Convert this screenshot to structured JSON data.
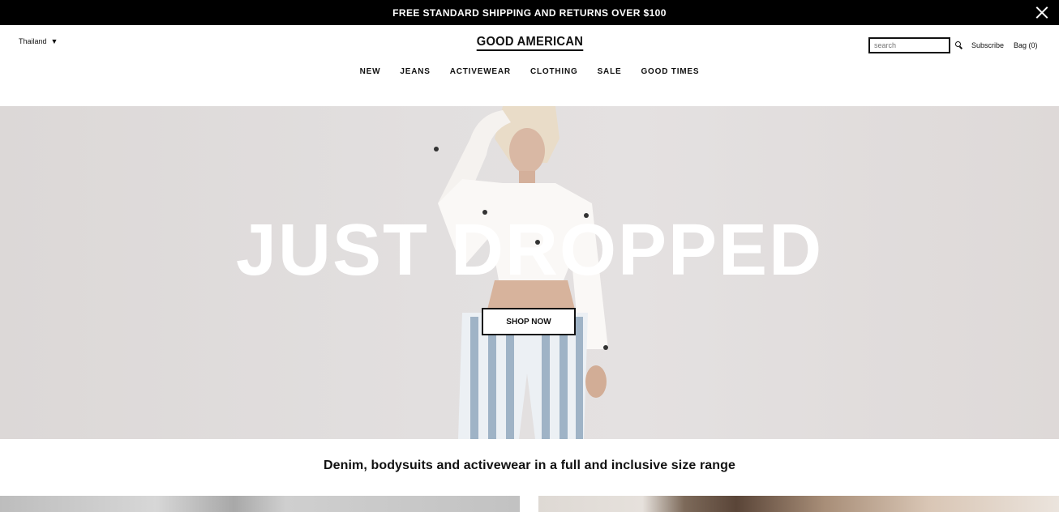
{
  "promo": {
    "text": "FREE STANDARD SHIPPING AND RETURNS OVER $100",
    "close_icon": "close-icon"
  },
  "header": {
    "country": "Thailand",
    "country_caret": "▼",
    "logo": "GOOD AMERICAN",
    "search_placeholder": "search",
    "search_icon": "search-icon",
    "subscribe": "Subscribe",
    "bag": "Bag (0)"
  },
  "nav": {
    "items": [
      "NEW",
      "JEANS",
      "ACTIVEWEAR",
      "CLOTHING",
      "SALE",
      "GOOD TIMES"
    ]
  },
  "hero": {
    "title": "JUST DROPPED",
    "cta": "SHOP NOW"
  },
  "tagline": "Denim, bodysuits and activewear in a full and inclusive size range",
  "colors": {
    "promo_bg": "#000000",
    "hero_bg": "#e2dfdf",
    "text": "#111111"
  }
}
